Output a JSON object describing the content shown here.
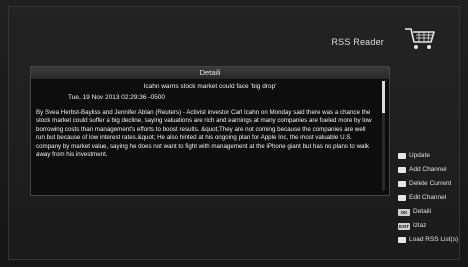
{
  "header": {
    "title": "RSS Reader"
  },
  "panel": {
    "title": "Detaili",
    "article_title": "Icahn warns stock market could face 'big drop'",
    "article_date": "Tue, 19 Nov 2013 02:29:36 -0500",
    "article_body": "By Svea Herbst-Bayliss and Jennifer Ablan (Reuters) - Activist investor Carl Icahn on Monday said there was a chance the stock market could suffer a big decline, saying valuations are rich and earnings at many companies are fueled more by low borrowing costs than management's efforts to boost results. &quot;They are not coming because the companies are well run but because of low interest rates.&quot; He also hinted at his ongoing plan for Apple Inc, the most valuable U.S. company by market value, saying he does not want to fight with management at the iPhone giant but has no plans to walk away from his investment."
  },
  "legend": {
    "items": [
      {
        "label": "Update",
        "key": "color-key",
        "key_text": ""
      },
      {
        "label": "Add Channel",
        "key": "color-key",
        "key_text": ""
      },
      {
        "label": "Delete Current",
        "key": "color-key",
        "key_text": ""
      },
      {
        "label": "Edit Channel",
        "key": "color-key",
        "key_text": ""
      },
      {
        "label": "Detaili",
        "key": "ok-key",
        "key_text": "OK"
      },
      {
        "label": "Izlaz",
        "key": "exit-key",
        "key_text": "EXIT"
      },
      {
        "label": "Load RSS List(s)",
        "key": "color-key",
        "key_text": ""
      }
    ]
  },
  "icons": {
    "cart": "shopping-cart-icon"
  }
}
